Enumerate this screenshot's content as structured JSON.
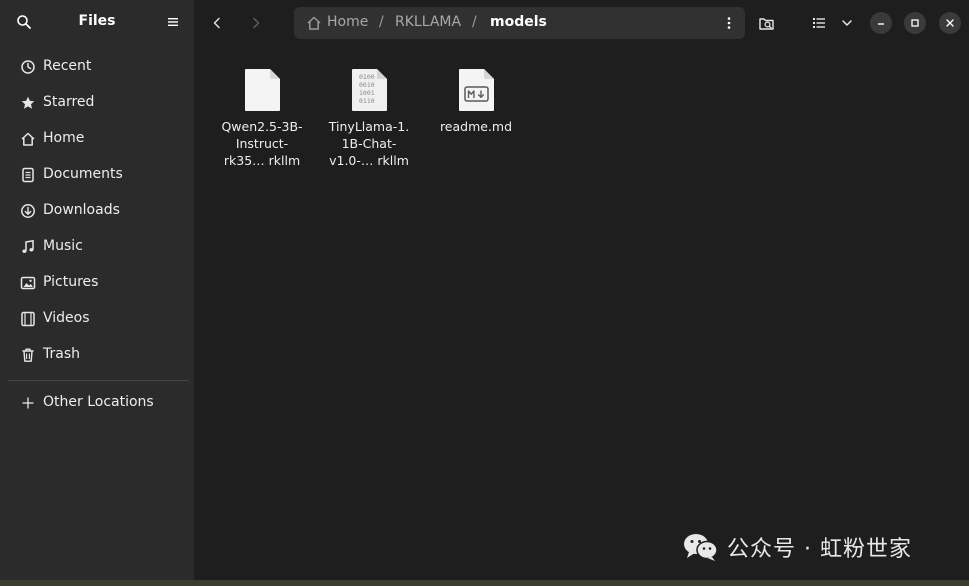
{
  "app": {
    "title": "Files"
  },
  "sidebar": {
    "items": [
      {
        "label": "Recent",
        "icon": "clock-icon"
      },
      {
        "label": "Starred",
        "icon": "star-icon"
      },
      {
        "label": "Home",
        "icon": "home-icon"
      },
      {
        "label": "Documents",
        "icon": "document-icon"
      },
      {
        "label": "Downloads",
        "icon": "download-icon"
      },
      {
        "label": "Music",
        "icon": "music-note-icon"
      },
      {
        "label": "Pictures",
        "icon": "picture-icon"
      },
      {
        "label": "Videos",
        "icon": "film-icon"
      },
      {
        "label": "Trash",
        "icon": "trash-icon"
      }
    ],
    "other": {
      "label": "Other Locations",
      "icon": "plus-icon"
    }
  },
  "breadcrumb": {
    "items": [
      "Home",
      "RKLLAMA",
      "models"
    ],
    "separator": "/"
  },
  "files": [
    {
      "line1": "Qwen2.5-3B-",
      "line2": "Instruct-",
      "line3": "rk35… rkllm",
      "icon": "generic-file-icon"
    },
    {
      "line1": "TinyLlama-1.",
      "line2": "1B-Chat-",
      "line3": "v1.0-… rkllm",
      "icon": "binary-file-icon"
    },
    {
      "line1": "readme.md",
      "line2": "",
      "line3": "",
      "icon": "markdown-file-icon"
    }
  ],
  "watermark": {
    "text": "公众号 · 虹粉世家",
    "icon": "wechat-icon"
  },
  "colors": {
    "sidebar_bg": "#2b2b2b",
    "content_bg": "#1e1e1e",
    "pathbar_bg": "#313131",
    "text": "#ffffff"
  }
}
